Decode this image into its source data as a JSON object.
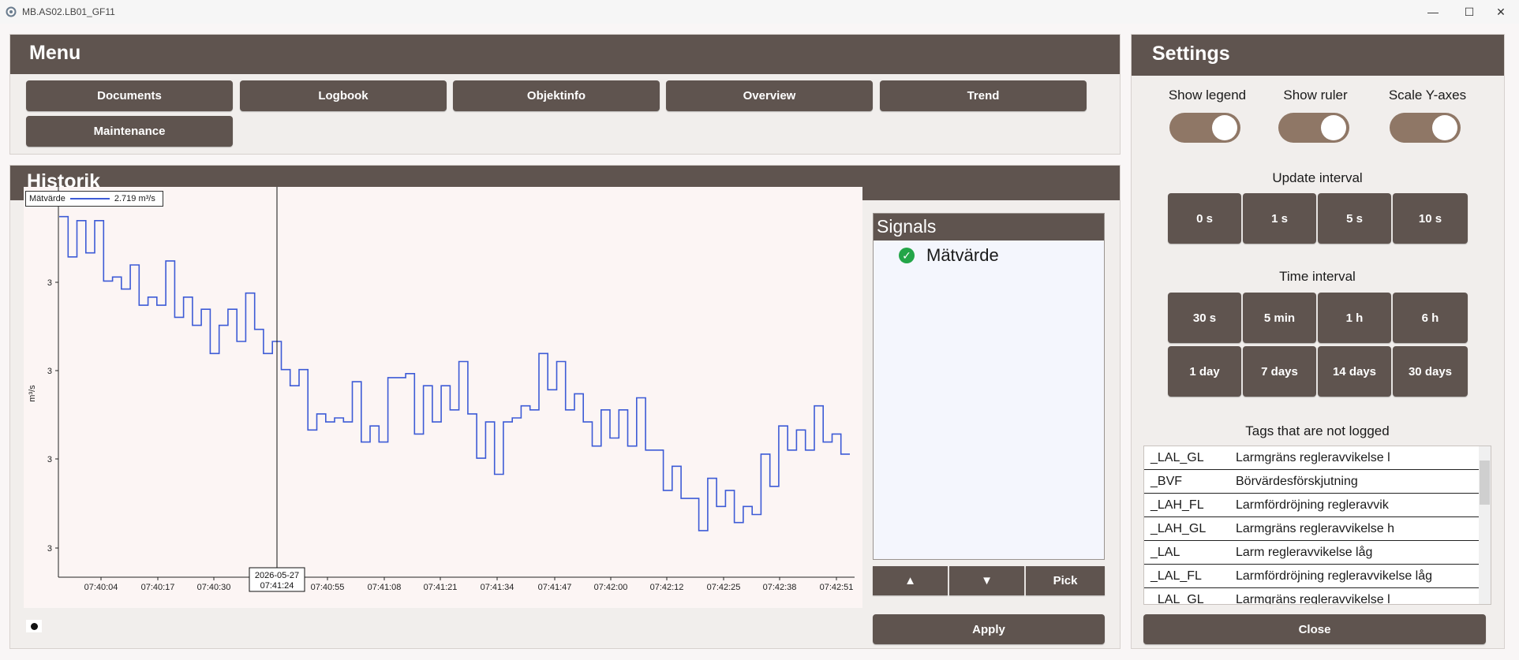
{
  "window": {
    "title": "MB.AS02.LB01_GF11",
    "minimize": "—",
    "maximize": "☐",
    "close": "✕"
  },
  "menu": {
    "title": "Menu",
    "buttons": [
      "Documents",
      "Logbook",
      "Objektinfo",
      "Overview",
      "Trend",
      "Maintenance"
    ]
  },
  "historik": {
    "title": "Historik"
  },
  "chart_data": {
    "type": "line",
    "title": "",
    "xlabel": "",
    "ylabel": "m³/s",
    "legend": {
      "placement": "top-left",
      "series_name": "Mätvärde",
      "value_text": "2.719 m³/s"
    },
    "y_tick_labels": [
      "3",
      "3",
      "3",
      "3"
    ],
    "x_tick_labels": [
      "07:40:04",
      "07:40:17",
      "07:40:30",
      "07:40:55",
      "07:41:08",
      "07:41:21",
      "07:41:34",
      "07:41:47",
      "07:42:00",
      "07:42:12",
      "07:42:25",
      "07:42:38",
      "07:42:51"
    ],
    "ruler": {
      "date": "2026-05-27",
      "time": "07:41:24"
    },
    "ylim": [
      2.1,
      3.05
    ],
    "grid": false,
    "series": [
      {
        "name": "Mätvärde",
        "step": "after",
        "values": [
          2.98,
          2.88,
          2.97,
          2.89,
          2.97,
          2.82,
          2.83,
          2.8,
          2.86,
          2.76,
          2.78,
          2.76,
          2.87,
          2.73,
          2.78,
          2.71,
          2.75,
          2.64,
          2.71,
          2.75,
          2.67,
          2.79,
          2.7,
          2.64,
          2.67,
          2.6,
          2.56,
          2.6,
          2.45,
          2.49,
          2.47,
          2.48,
          2.47,
          2.57,
          2.42,
          2.46,
          2.42,
          2.58,
          2.58,
          2.59,
          2.44,
          2.56,
          2.47,
          2.56,
          2.5,
          2.62,
          2.49,
          2.38,
          2.47,
          2.34,
          2.47,
          2.48,
          2.51,
          2.5,
          2.64,
          2.55,
          2.62,
          2.5,
          2.54,
          2.47,
          2.41,
          2.5,
          2.43,
          2.5,
          2.41,
          2.53,
          2.4,
          2.4,
          2.3,
          2.36,
          2.28,
          2.28,
          2.2,
          2.33,
          2.26,
          2.3,
          2.22,
          2.26,
          2.24,
          2.39,
          2.31,
          2.46,
          2.4,
          2.45,
          2.4,
          2.51,
          2.42,
          2.44,
          2.39,
          2.39
        ]
      }
    ]
  },
  "signals": {
    "title": "Signals",
    "items": [
      "Mätvärde"
    ],
    "up_label": "▲",
    "down_label": "▼",
    "pick_label": "Pick",
    "apply_label": "Apply"
  },
  "settings": {
    "title": "Settings",
    "toggles": [
      {
        "label": "Show legend",
        "on": true
      },
      {
        "label": "Show ruler",
        "on": true
      },
      {
        "label": "Scale Y-axes",
        "on": true
      }
    ],
    "update_interval_label": "Update interval",
    "update_intervals": [
      "0 s",
      "1 s",
      "5 s",
      "10 s"
    ],
    "time_interval_label": "Time interval",
    "time_intervals": [
      "30 s",
      "5 min",
      "1 h",
      "6 h",
      "1 day",
      "7 days",
      "14 days",
      "30 days"
    ],
    "tags_label": "Tags that are not logged",
    "tags": [
      {
        "tag": "_LAL_GL",
        "desc": "Larmgräns regleravvikelse l"
      },
      {
        "tag": "_BVF",
        "desc": "Börvärdesförskjutning"
      },
      {
        "tag": "_LAH_FL",
        "desc": "Larmfördröjning regleravvik"
      },
      {
        "tag": "_LAH_GL",
        "desc": "Larmgräns regleravvikelse h"
      },
      {
        "tag": "_LAL",
        "desc": "Larm regleravvikelse låg"
      },
      {
        "tag": "_LAL_FL",
        "desc": "Larmfördröjning regleravvikelse låg"
      },
      {
        "tag": "_LAL_GL",
        "desc": "Larmgräns regleravvikelse l"
      }
    ],
    "close_label": "Close"
  },
  "colors": {
    "header": "#5f544f",
    "series": "#3d5bd6",
    "toggle": "#8f7766",
    "check": "#23a548"
  }
}
